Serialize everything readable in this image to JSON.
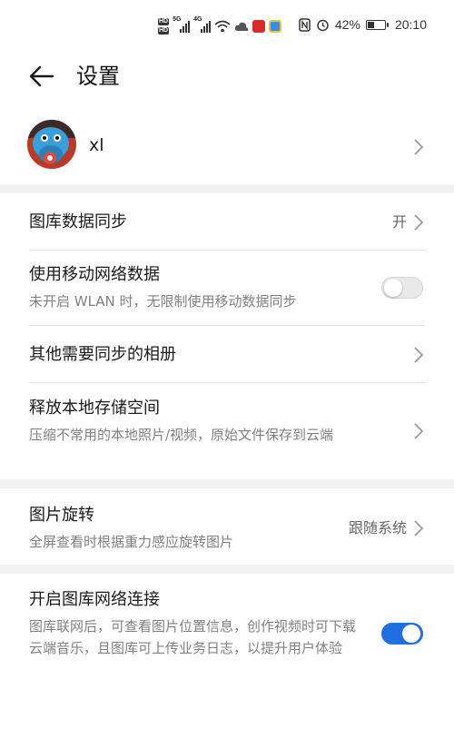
{
  "status_bar": {
    "hd_labels": [
      "HD",
      "HD"
    ],
    "signal_labels": [
      "5G",
      "4G"
    ],
    "battery_text": "42%",
    "battery_level": 0.42,
    "time": "20:10"
  },
  "header": {
    "title": "设置"
  },
  "profile": {
    "name": "xl"
  },
  "settings": [
    {
      "title": "图库数据同步",
      "value": "开"
    },
    {
      "title": "使用移动网络数据",
      "subtitle": "未开启 WLAN 时，无限制使用移动数据同步",
      "toggle": false
    },
    {
      "title": "其他需要同步的相册"
    },
    {
      "title": "释放本地存储空间",
      "subtitle": "压缩不常用的本地照片/视频，原始文件保存到云端"
    },
    {
      "title": "图片旋转",
      "subtitle": "全屏查看时根据重力感应旋转图片",
      "value": "跟随系统"
    },
    {
      "title": "开启图库网络连接",
      "subtitle": "图库联网后，可查看图片位置信息，创作视频时可下载云端音乐，且图库可上传业务日志，以提升用户体验",
      "toggle": true
    }
  ],
  "colors": {
    "accent": "#1f6fe0",
    "section_gap": "#f2f2f2",
    "secondary_text": "#808080"
  }
}
